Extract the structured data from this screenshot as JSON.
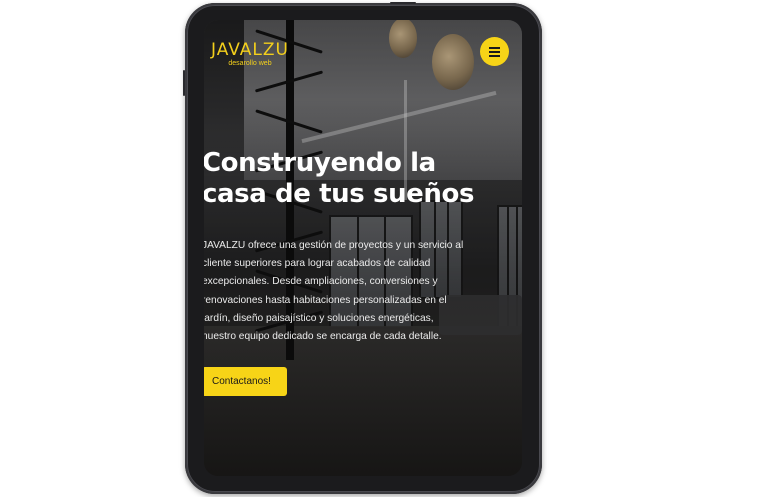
{
  "brand": {
    "name": "JAVALZU",
    "tagline": "desarollo web"
  },
  "menu": {
    "icon": "hamburger-icon",
    "color": "#f7d417"
  },
  "hero": {
    "title_line1": "Construyendo la",
    "title_line2": "casa de tus sueños",
    "description": "JAVALZU ofrece una gestión de proyectos y un servicio al cliente superiores para lograr acabados de calidad excepcionales. Desde ampliaciones, conversiones y renovaciones hasta habitaciones personalizadas en el jardín, diseño paisajístico y soluciones energéticas, nuestro equipo dedicado se encarga de cada detalle.",
    "cta_label": "Contactanos!"
  },
  "colors": {
    "accent": "#f7d417",
    "brand_text": "#f3cf1c",
    "device": "#1b1b1d"
  }
}
